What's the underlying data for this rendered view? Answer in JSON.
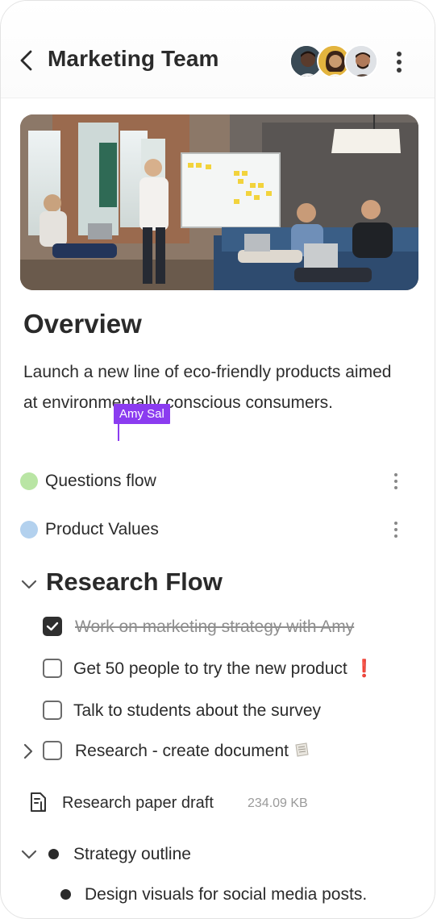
{
  "header": {
    "title": "Marketing Team",
    "back_icon": "chevron-left-icon",
    "more_icon": "more-vertical-icon",
    "avatars": [
      {
        "name": "member-avatar-1",
        "skin": "#5a3b2c",
        "bg": "#2f3a44"
      },
      {
        "name": "member-avatar-2",
        "skin": "#c99a6e",
        "bg": "#e0b23c"
      },
      {
        "name": "member-avatar-3",
        "skin": "#b07a5a",
        "bg": "#d9dde2"
      }
    ]
  },
  "overview": {
    "heading": "Overview",
    "description": "Launch a new line of eco-friendly products aimed at environmentally conscious consumers.",
    "collaborator_cursor": {
      "label": "Amy Sal",
      "color": "#8b3cf0"
    }
  },
  "tags": [
    {
      "label": "Questions flow",
      "color": "#b9e5a4"
    },
    {
      "label": "Product Values",
      "color": "#b3d1ee"
    }
  ],
  "research": {
    "heading": "Research Flow",
    "tasks": [
      {
        "label": "Work on marketing strategy with Amy",
        "checked": true
      },
      {
        "label": "Get 50 people to try the new product",
        "checked": false,
        "flag": "❗"
      },
      {
        "label": "Talk to students about the survey",
        "checked": false
      },
      {
        "label": "Research - create document",
        "checked": false,
        "icon": "document-emoji-icon"
      }
    ]
  },
  "file": {
    "name": "Research paper draft",
    "size": "234.09 KB",
    "icon": "file-clip-icon"
  },
  "outline": {
    "items": [
      {
        "label": "Strategy outline"
      },
      {
        "label": "Design visuals for social media posts."
      }
    ]
  },
  "colors": {
    "accent": "#8b3cf0",
    "danger": "#d0121b"
  }
}
